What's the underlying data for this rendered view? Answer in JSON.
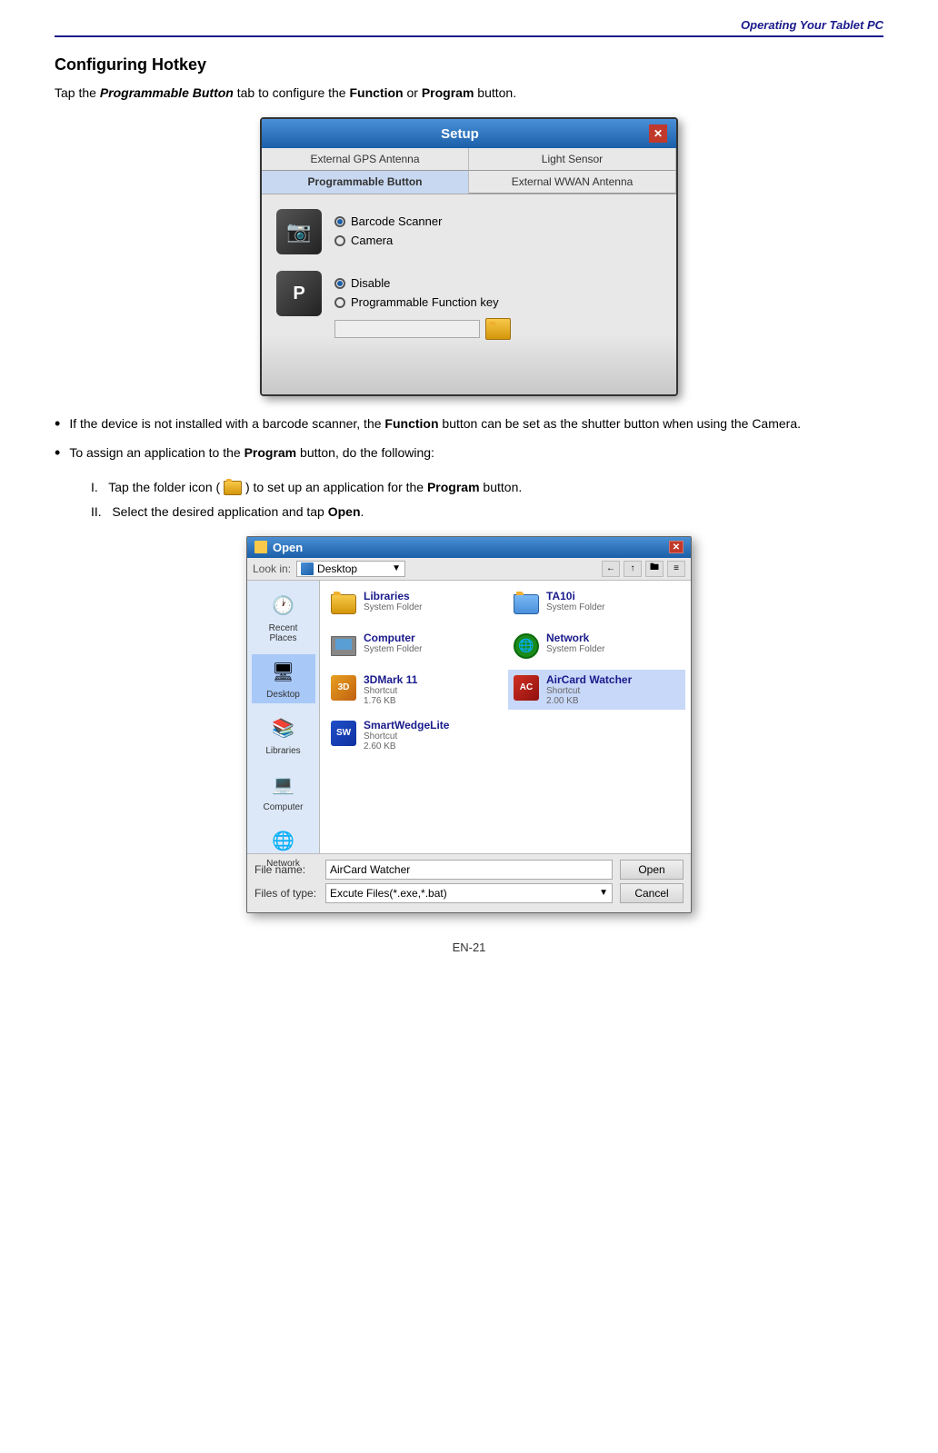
{
  "header": {
    "title": "Operating Your Tablet PC"
  },
  "section": {
    "title": "Configuring Hotkey",
    "intro": "Tap the ",
    "intro_bold_italic": "Programmable Button",
    "intro_mid": " tab to configure the ",
    "intro_bold1": "Function",
    "intro_mid2": " or ",
    "intro_bold2": "Program",
    "intro_end": " button."
  },
  "setup_dialog": {
    "title": "Setup",
    "close": "✕",
    "tabs": [
      {
        "label": "External GPS Antenna",
        "active": false
      },
      {
        "label": "Light Sensor",
        "active": false
      },
      {
        "label": "Programmable Button",
        "active": true
      },
      {
        "label": "External WWAN Antenna",
        "active": false
      }
    ],
    "row1": {
      "icon": "📷",
      "radio1": "Barcode Scanner",
      "radio1_selected": true,
      "radio2": "Camera",
      "radio2_selected": false
    },
    "row2": {
      "icon": "P",
      "radio1": "Disable",
      "radio1_selected": true,
      "radio2": "Programmable Function key",
      "radio2_selected": false
    }
  },
  "bullets": [
    {
      "text_pre": "If the device is not installed with a barcode scanner, the ",
      "bold": "Function",
      "text_post": " button can be set as the shutter button when using the Camera."
    },
    {
      "text_pre": "To assign an application to the ",
      "bold": "Program",
      "text_post": " button, do the following:"
    }
  ],
  "numbered_steps": [
    {
      "num": "I.",
      "text_pre": "Tap the folder icon (",
      "folder": true,
      "text_post": ") to set up an application for the ",
      "bold": "Program",
      "text_end": " button."
    },
    {
      "num": "II.",
      "text_pre": "Select the desired application and tap ",
      "bold": "Open",
      "text_end": "."
    }
  ],
  "open_dialog": {
    "title": "Open",
    "close": "✕",
    "toolbar": {
      "look_in_label": "Look in:",
      "look_in_value": "Desktop",
      "nav_back": "←",
      "nav_up": "↑",
      "nav_new": "🖿",
      "nav_views": "≡"
    },
    "sidebar_items": [
      {
        "label": "Recent Places",
        "icon": "🕐"
      },
      {
        "label": "Desktop",
        "icon": "🖥",
        "selected": true
      },
      {
        "label": "Libraries",
        "icon": "📚"
      },
      {
        "label": "Computer",
        "icon": "💻"
      },
      {
        "label": "Network",
        "icon": "🌐"
      }
    ],
    "files": [
      {
        "name": "Libraries",
        "type": "System Folder",
        "icon": "folder",
        "col": 1
      },
      {
        "name": "TA10i",
        "type": "System Folder",
        "icon": "folder-blue",
        "col": 2
      },
      {
        "name": "Computer",
        "type": "System Folder",
        "icon": "computer",
        "col": 1
      },
      {
        "name": "Network",
        "type": "System Folder",
        "icon": "network",
        "col": 2
      },
      {
        "name": "3DMark 11",
        "type": "Shortcut",
        "size": "1.76 KB",
        "icon": "shortcut-3d",
        "col": 1
      },
      {
        "name": "AirCard Watcher",
        "type": "Shortcut",
        "size": "2.00 KB",
        "icon": "shortcut-air",
        "col": 2,
        "selected": true
      },
      {
        "name": "SmartWedgeLite",
        "type": "Shortcut",
        "size": "2.60 KB",
        "icon": "shortcut-sw",
        "col": 1
      }
    ],
    "footer": {
      "filename_label": "File name:",
      "filename_value": "AirCard Watcher",
      "filetype_label": "Files of type:",
      "filetype_value": "Excute Files(*.exe,*.bat)",
      "open_btn": "Open",
      "cancel_btn": "Cancel"
    }
  },
  "page_footer": {
    "text": "EN-21"
  }
}
